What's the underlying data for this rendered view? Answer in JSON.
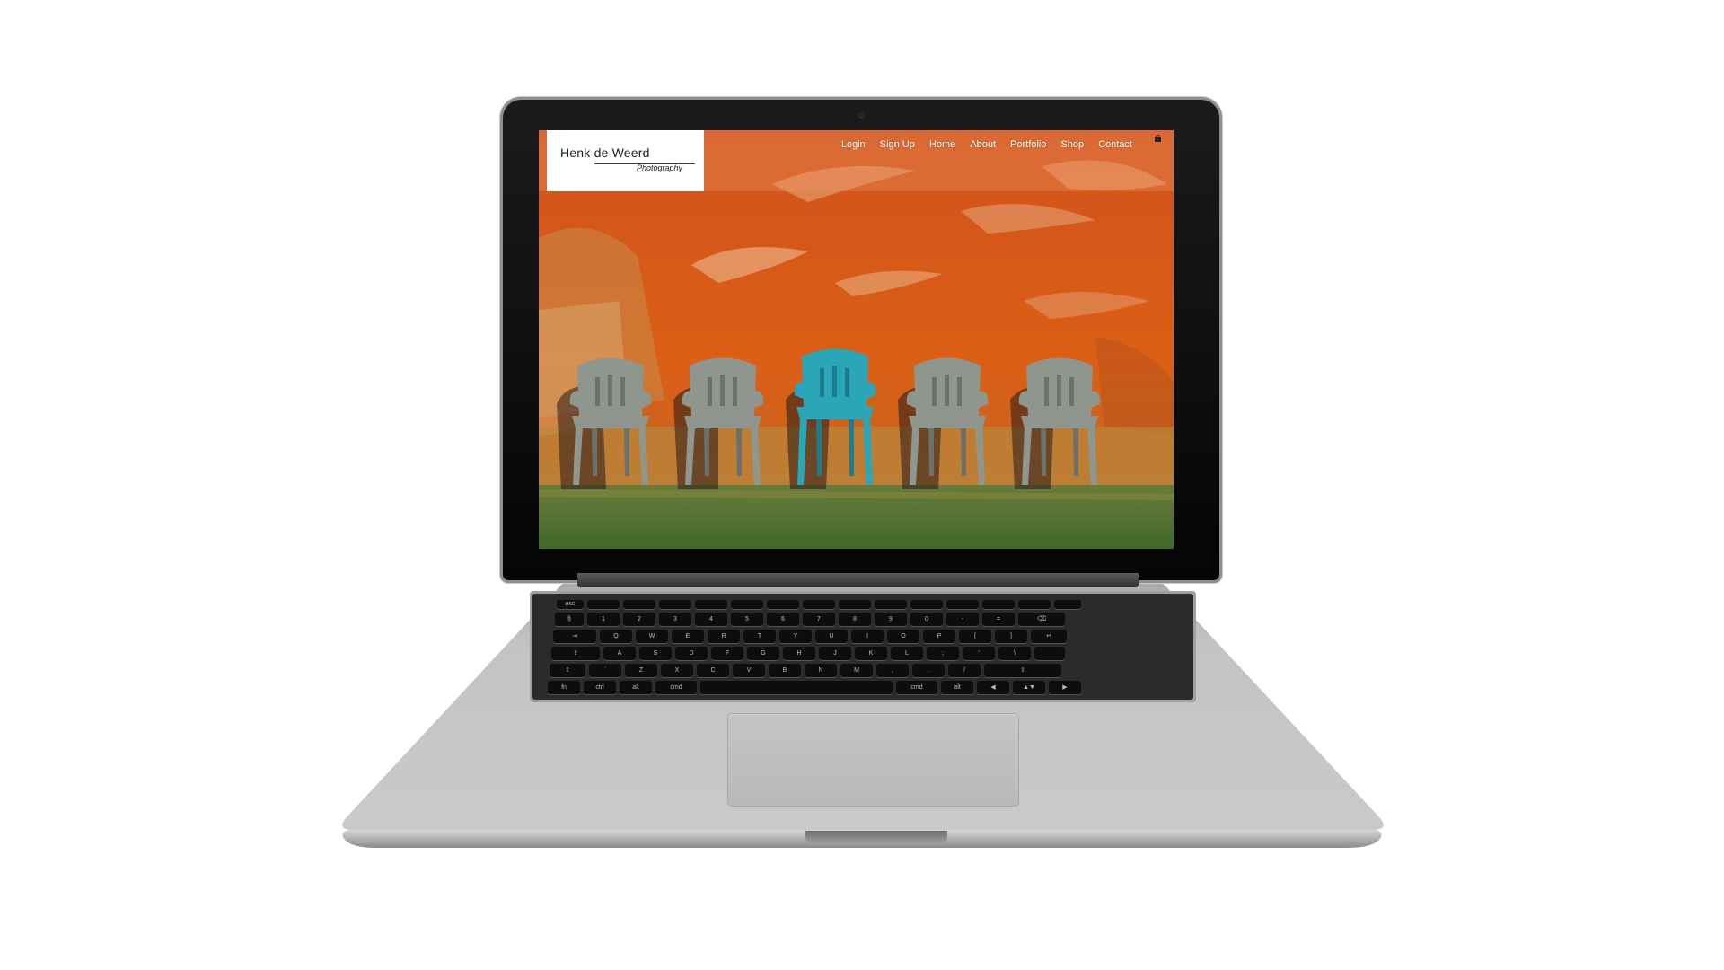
{
  "website": {
    "logo": {
      "name": "Henk de Weerd",
      "subtitle": "Photography"
    },
    "nav": {
      "items": [
        {
          "label": "Login"
        },
        {
          "label": "Sign Up"
        },
        {
          "label": "Home"
        },
        {
          "label": "About"
        },
        {
          "label": "Portfolio"
        },
        {
          "label": "Shop"
        },
        {
          "label": "Contact"
        }
      ],
      "cart_icon": "shopping-bag-icon"
    },
    "hero_image": {
      "subject": "five plastic chairs in front of an orange wall, the middle chair is turquoise",
      "colors": {
        "wall": "#d4561a",
        "grass": "#4f7a33",
        "chair_grey": "#8f968d",
        "chair_accent": "#2aa6b8"
      }
    }
  },
  "device": {
    "type": "laptop",
    "colors": {
      "aluminium": "#b9babc",
      "bezel": "#0a0a0a",
      "keys": "#0d0d0d"
    }
  }
}
